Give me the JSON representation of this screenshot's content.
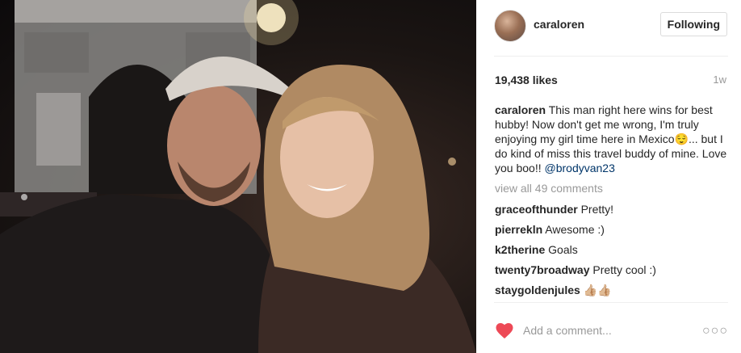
{
  "post": {
    "photo_icon": "photo",
    "author": {
      "username": "caraloren",
      "follow_label": "Following"
    },
    "likes": "19,438 likes",
    "age": "1w",
    "caption": {
      "username": "caraloren",
      "text": "This man right here wins for best hubby! Now don't get me wrong, I'm truly enjoying my girl time here in Mexico😌... but I do kind of miss this travel buddy of mine. Love you boo!! ",
      "mention": "@brodyvan23"
    },
    "view_all": "view all 49 comments",
    "comments": [
      {
        "user": "graceofthunder",
        "text": "Pretty!"
      },
      {
        "user": "pierrekln",
        "text": "Awesome :)"
      },
      {
        "user": "k2therine",
        "text": "Goals"
      },
      {
        "user": "twenty7broadway",
        "text": "Pretty cool :)"
      },
      {
        "user": "staygoldenjules",
        "text": "👍🏼👍🏼"
      }
    ],
    "footer": {
      "like_icon": "heart-icon",
      "like_color": "#ed4956",
      "comment_placeholder": "Add a comment...",
      "more_label": "○○○"
    }
  }
}
